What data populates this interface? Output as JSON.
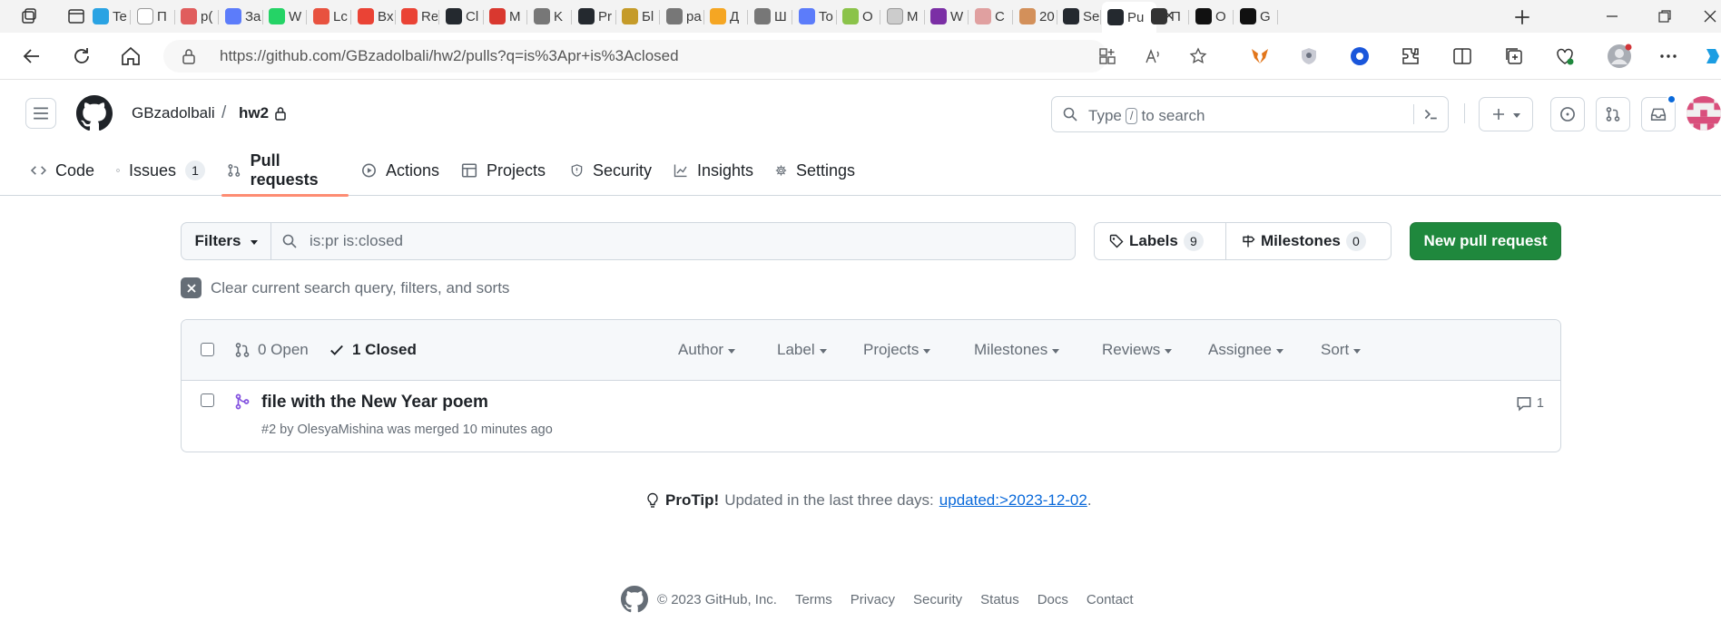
{
  "browser": {
    "tabs": [
      {
        "label": "Te",
        "color": "#2aa3e3"
      },
      {
        "label": "П",
        "color": "#ffffff"
      },
      {
        "label": "р(",
        "color": "#e05d5d"
      },
      {
        "label": "За",
        "color": "#5c7cfa"
      },
      {
        "label": "W",
        "color": "#25d366"
      },
      {
        "label": "Lc",
        "color": "#e8523f"
      },
      {
        "label": "Bx",
        "color": "#ea4335"
      },
      {
        "label": "Re",
        "color": "#ea4335"
      },
      {
        "label": "Cl",
        "color": "#24292f"
      },
      {
        "label": "M",
        "color": "#d9382f"
      },
      {
        "label": "K",
        "color": "#777777"
      },
      {
        "label": "Pr",
        "color": "#24292f"
      },
      {
        "label": "Бl",
        "color": "#c59b29"
      },
      {
        "label": "pa",
        "color": "#777777"
      },
      {
        "label": "Д",
        "color": "#f5a623"
      },
      {
        "label": "Ш",
        "color": "#777777"
      },
      {
        "label": "To",
        "color": "#5c7cfa"
      },
      {
        "label": "О",
        "color": "#8bc34a"
      },
      {
        "label": "M",
        "color": "#cccccc"
      },
      {
        "label": "W",
        "color": "#7b2fa5"
      },
      {
        "label": "С",
        "color": "#e0a0a0"
      },
      {
        "label": "20",
        "color": "#d3905a"
      },
      {
        "label": "Se",
        "color": "#24292f"
      },
      {
        "label": "Pu",
        "color": "#24292f"
      },
      {
        "label": "П",
        "color": "#333333"
      },
      {
        "label": "О",
        "color": "#111111"
      },
      {
        "label": "G",
        "color": "#111111"
      }
    ],
    "address": "https://github.com/GBzadolbali/hw2/pulls?q=is%3Apr+is%3Aclosed"
  },
  "header": {
    "owner": "GBzadolbali",
    "separator": "/",
    "repo": "hw2",
    "search_prefix": "Type",
    "search_key": "/",
    "search_suffix": "to search"
  },
  "repo_tabs": [
    {
      "label": "Code",
      "icon": "code-icon",
      "counter": ""
    },
    {
      "label": "Issues",
      "icon": "issue-opened-icon",
      "counter": "1"
    },
    {
      "label": "Pull requests",
      "icon": "git-pull-request-icon",
      "counter": ""
    },
    {
      "label": "Actions",
      "icon": "play-icon",
      "counter": ""
    },
    {
      "label": "Projects",
      "icon": "table-icon",
      "counter": ""
    },
    {
      "label": "Security",
      "icon": "shield-icon",
      "counter": ""
    },
    {
      "label": "Insights",
      "icon": "graph-icon",
      "counter": ""
    },
    {
      "label": "Settings",
      "icon": "gear-icon",
      "counter": ""
    }
  ],
  "toolbar": {
    "filters_label": "Filters",
    "query": "is:pr is:closed",
    "labels_label": "Labels",
    "labels_count": "9",
    "milestones_label": "Milestones",
    "milestones_count": "0",
    "new_pr_label": "New pull request"
  },
  "clear_query": "Clear current search query, filters, and sorts",
  "list_header": {
    "open_label": "0 Open",
    "closed_label": "1 Closed",
    "filters": [
      "Author",
      "Label",
      "Projects",
      "Milestones",
      "Reviews",
      "Assignee",
      "Sort"
    ]
  },
  "pull_requests": [
    {
      "title": "file with the New Year poem",
      "number": "#2",
      "by": "by",
      "author": "OlesyaMishina",
      "status": "was merged 10 minutes ago",
      "comments": "1"
    }
  ],
  "protip": {
    "label": "ProTip!",
    "text": "Updated in the last three days:",
    "link": "updated:>2023-12-02",
    "end": "."
  },
  "footer": {
    "copyright": "© 2023 GitHub, Inc.",
    "links": [
      "Terms",
      "Privacy",
      "Security",
      "Status",
      "Docs",
      "Contact"
    ]
  },
  "colors": {
    "accent_green": "#1f883d",
    "link_blue": "#0969da",
    "merged_purple": "#8250df",
    "tab_underline": "#fd8c73"
  }
}
